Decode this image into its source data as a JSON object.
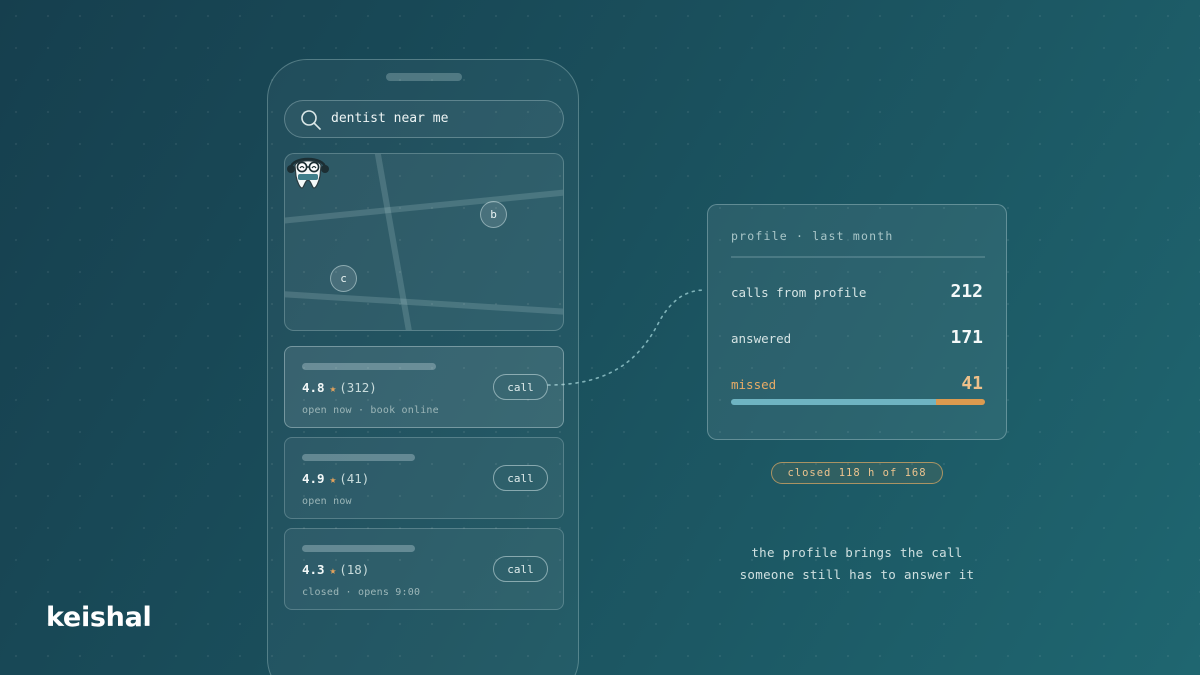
{
  "brand": {
    "name": "keishal"
  },
  "search": {
    "query": "dentist near me",
    "icon": "search-icon"
  },
  "map": {
    "pins": [
      {
        "label": "b"
      },
      {
        "label": "c"
      }
    ],
    "marker_icon": "tooth-icon"
  },
  "results": [
    {
      "rating": "4.8",
      "reviews": "(312)",
      "status": "open now · book online",
      "call_label": "call",
      "active": true
    },
    {
      "rating": "4.9",
      "reviews": "(41)",
      "status": "open now",
      "call_label": "call",
      "active": false
    },
    {
      "rating": "4.3",
      "reviews": "(18)",
      "status": "closed · opens 9:00",
      "call_label": "call",
      "active": false
    }
  ],
  "stats": {
    "title": "profile · last month",
    "rows": [
      {
        "label": "calls from profile",
        "value": "212"
      },
      {
        "label": "answered",
        "value": "171"
      },
      {
        "label": "missed",
        "value": "41"
      }
    ],
    "answered_fraction": 0.807
  },
  "closed_badge": "closed 118 h of 168",
  "caption": {
    "line1": "the profile brings the call",
    "line2": "someone still has to answer it"
  },
  "colors": {
    "accent_missed": "#dc9a4f",
    "accent_answered": "#6fb4c2",
    "star": "#e4a35c"
  }
}
